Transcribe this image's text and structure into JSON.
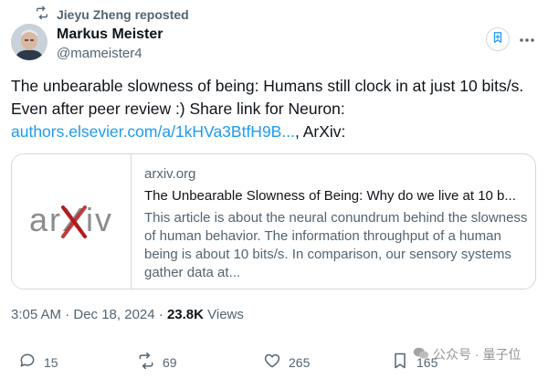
{
  "repost": {
    "text": "Jieyu Zheng reposted"
  },
  "author": {
    "name": "Markus Meister",
    "handle": "@mameister4"
  },
  "tweet": {
    "line1": "The unbearable slowness of being: Humans still clock in at just 10 bits/s.",
    "line2": "Even after peer review :) Share link for Neuron:",
    "link_text": "authors.elsevier.com/a/1kHVa3BtfH9B...",
    "after_link": ", ArXiv:"
  },
  "card": {
    "logo_text": "arXiv",
    "domain": "arxiv.org",
    "title": "The Unbearable Slowness of Being: Why do we live at 10 b...",
    "description": "This article is about the neural conundrum behind the slowness of human behavior. The information throughput of a human being is about 10 bits/s. In comparison, our sensory systems gather data at..."
  },
  "meta": {
    "timestamp": "3:05 AM · Dec 18, 2024 · ",
    "views_count": "23.8K",
    "views_label": " Views"
  },
  "actions": {
    "replies": "15",
    "reposts": "69",
    "likes": "265",
    "bookmarks": "165"
  },
  "watermark": {
    "text": "公众号 · 量子位"
  },
  "colors": {
    "link": "#1d9bf0",
    "secondary": "#536471",
    "primary": "#0f1419",
    "arxiv_red": "#b31b1b",
    "arxiv_gray": "#8c8c8c"
  },
  "icons": [
    "repost-icon",
    "subscribe-icon",
    "more-icon",
    "reply-icon",
    "like-icon",
    "bookmark-icon",
    "wechat-icon"
  ]
}
